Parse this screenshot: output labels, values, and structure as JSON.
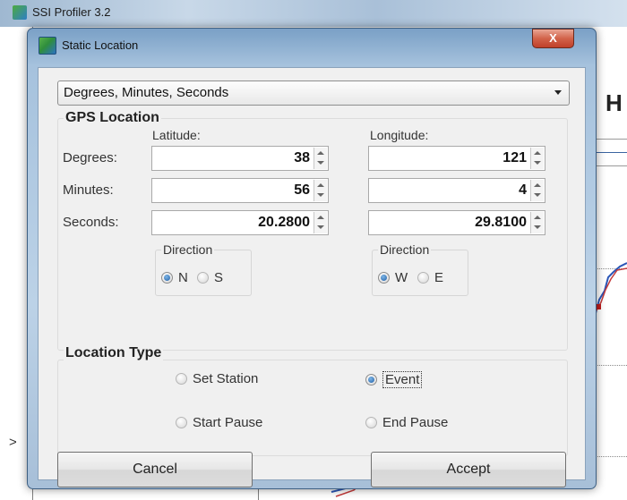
{
  "app": {
    "title": "SSI Profiler 3.2",
    "heading_partial": "H",
    "left_arrow": ">"
  },
  "dialog": {
    "title": "Static Location",
    "close_label": "X"
  },
  "format_select": {
    "value": "Degrees, Minutes, Seconds"
  },
  "gps": {
    "group_label": "GPS Location",
    "latitude_label": "Latitude:",
    "longitude_label": "Longitude:",
    "rows": {
      "degrees_label": "Degrees:",
      "minutes_label": "Minutes:",
      "seconds_label": "Seconds:"
    },
    "latitude": {
      "degrees": "38",
      "minutes": "56",
      "seconds": "20.2800"
    },
    "longitude": {
      "degrees": "121",
      "minutes": "4",
      "seconds": "29.8100"
    },
    "lat_direction": {
      "title": "Direction",
      "option_n": "N",
      "option_s": "S",
      "selected": "N"
    },
    "lon_direction": {
      "title": "Direction",
      "option_w": "W",
      "option_e": "E",
      "selected": "W"
    }
  },
  "location_type": {
    "group_label": "Location Type",
    "set_station": "Set Station",
    "event": "Event",
    "start_pause": "Start Pause",
    "end_pause": "End Pause",
    "selected": "Event"
  },
  "buttons": {
    "cancel": "Cancel",
    "accept": "Accept"
  },
  "colors": {
    "accent_radio": "#1f5fa7",
    "close_button": "#c0402a",
    "dialog_frame": "#a6c2dd"
  }
}
